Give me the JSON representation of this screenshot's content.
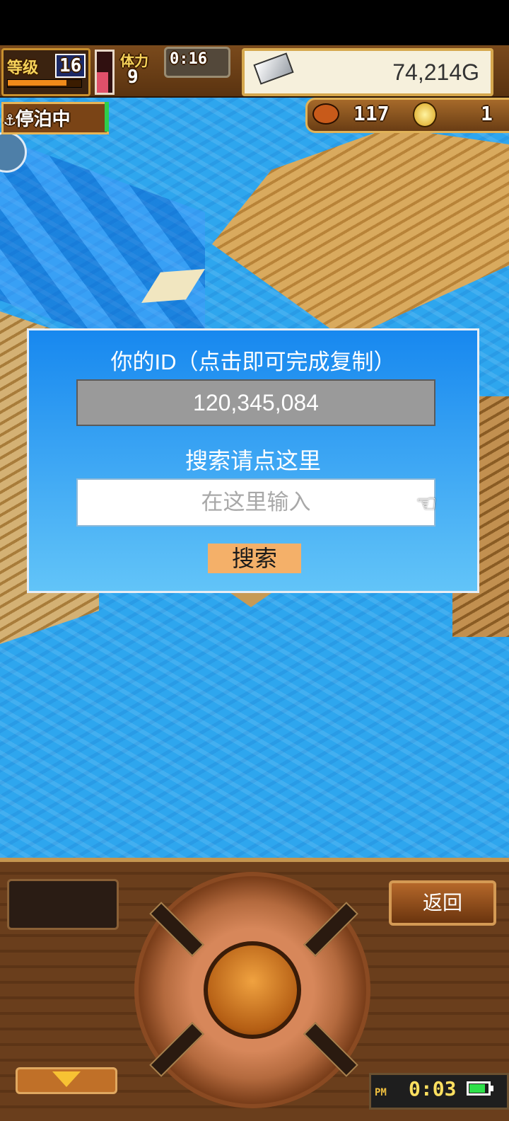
{
  "hud": {
    "level_label": "等级",
    "level_value": "16",
    "stamina_label": "体力",
    "stamina_value": "9",
    "timer": "0:16",
    "gold": "74,214G",
    "status": "停泊中",
    "food_count": "117",
    "coin_count": "1",
    "xp_fraction": 0.8,
    "hp_fraction": 0.55
  },
  "dialog": {
    "id_label": "你的ID（点击即可完成复制）",
    "id_value": "120,345,084",
    "search_label": "搜索请点这里",
    "search_placeholder": "在这里输入",
    "search_button": "搜索",
    "pointer_icon": "☜"
  },
  "controls": {
    "back_button": "返回",
    "clock_ampm": "PM",
    "clock_time": "0:03"
  },
  "colors": {
    "dialog_top": "#1788ef",
    "dialog_bottom": "#62c4f8",
    "search_button_bg": "#f4b069",
    "sea": "#2ea6ee"
  },
  "icons": [
    "anchor-icon",
    "silver-ingot-icon",
    "food-icon",
    "coin-icon",
    "pointing-hand-icon",
    "down-arrow-icon",
    "battery-icon",
    "compass-icon"
  ]
}
